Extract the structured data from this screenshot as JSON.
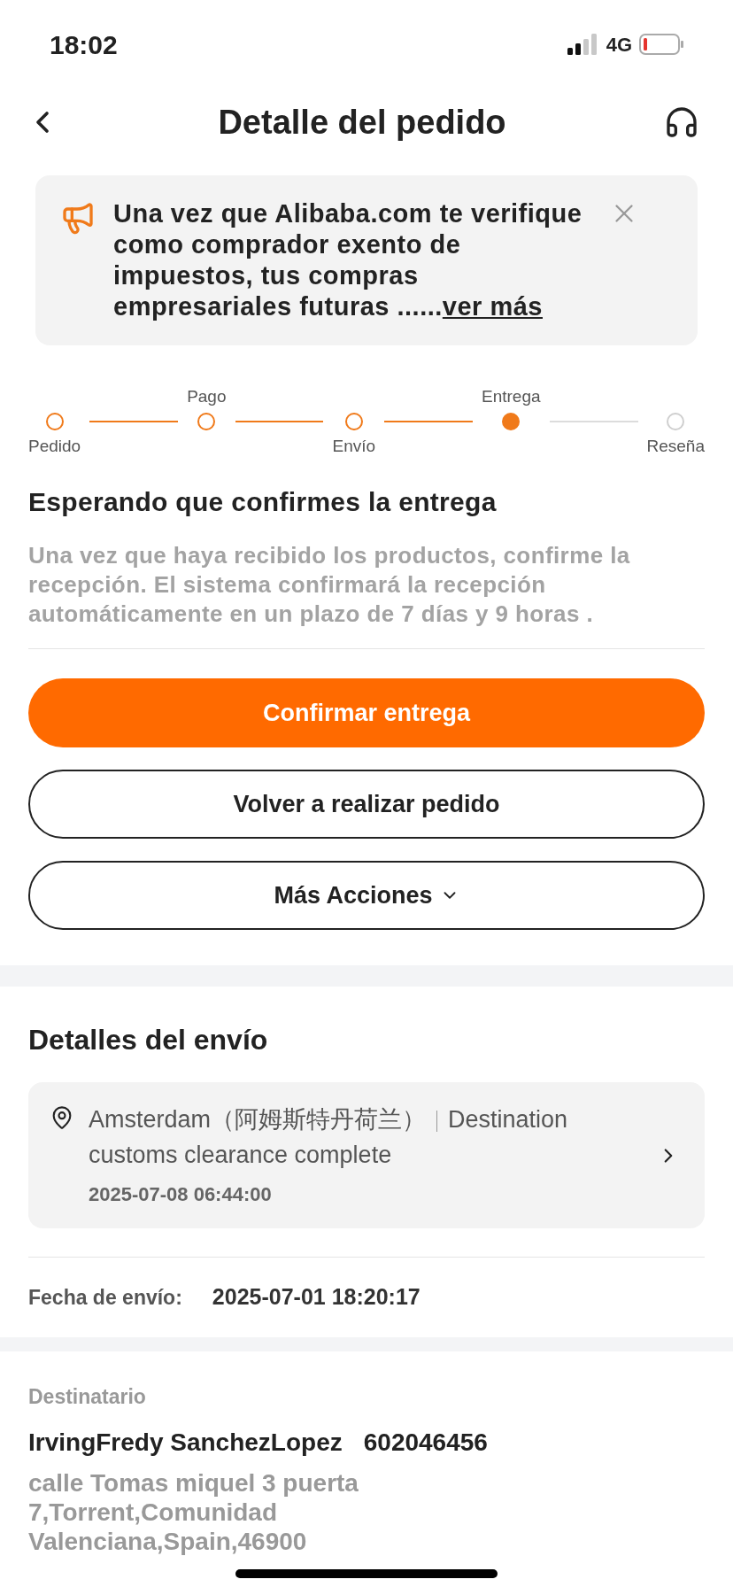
{
  "status_bar": {
    "time": "18:02",
    "network": "4G"
  },
  "header": {
    "title": "Detalle del pedido"
  },
  "notice": {
    "text": "Una vez que Alibaba.com te verifique como comprador exento de impuestos, tus compras empresariales futuras ......",
    "link": "ver más"
  },
  "steps": [
    {
      "label": "Pedido",
      "completed": true,
      "selected": false
    },
    {
      "label": "Pago",
      "completed": true,
      "selected": false
    },
    {
      "label": "Envío",
      "completed": true,
      "selected": false
    },
    {
      "label": "Entrega",
      "completed": true,
      "selected": true
    },
    {
      "label": "Reseña",
      "completed": false,
      "selected": false
    }
  ],
  "status": {
    "title": "Esperando que confirmes la entrega",
    "description": "Una vez que haya recibido los productos, confirme la recepción. El sistema confirmará la recepción automáticamente en un plazo de 7 días y 9 horas ."
  },
  "actions": [
    {
      "label": "Confirmar entrega",
      "kind": "primary"
    },
    {
      "label": "Volver a realizar pedido",
      "kind": "outline"
    },
    {
      "label": "Más Acciones",
      "kind": "dropdown"
    }
  ],
  "shipping": {
    "title": "Detalles del envío",
    "tracking": {
      "location": "Amsterdam（阿姆斯特丹荷兰）",
      "event": "Destination customs clearance complete",
      "time": "2025-07-08 06:44:00"
    },
    "date_label": "Fecha de envío:",
    "date_value": "2025-07-01 18:20:17"
  },
  "recipient": {
    "label": "Destinatario",
    "name": "IrvingFredy SanchezLopez",
    "phone": "602046456",
    "address": "calle Tomas miquel 3 puerta 7,Torrent,Comunidad Valenciana,Spain,46900"
  }
}
